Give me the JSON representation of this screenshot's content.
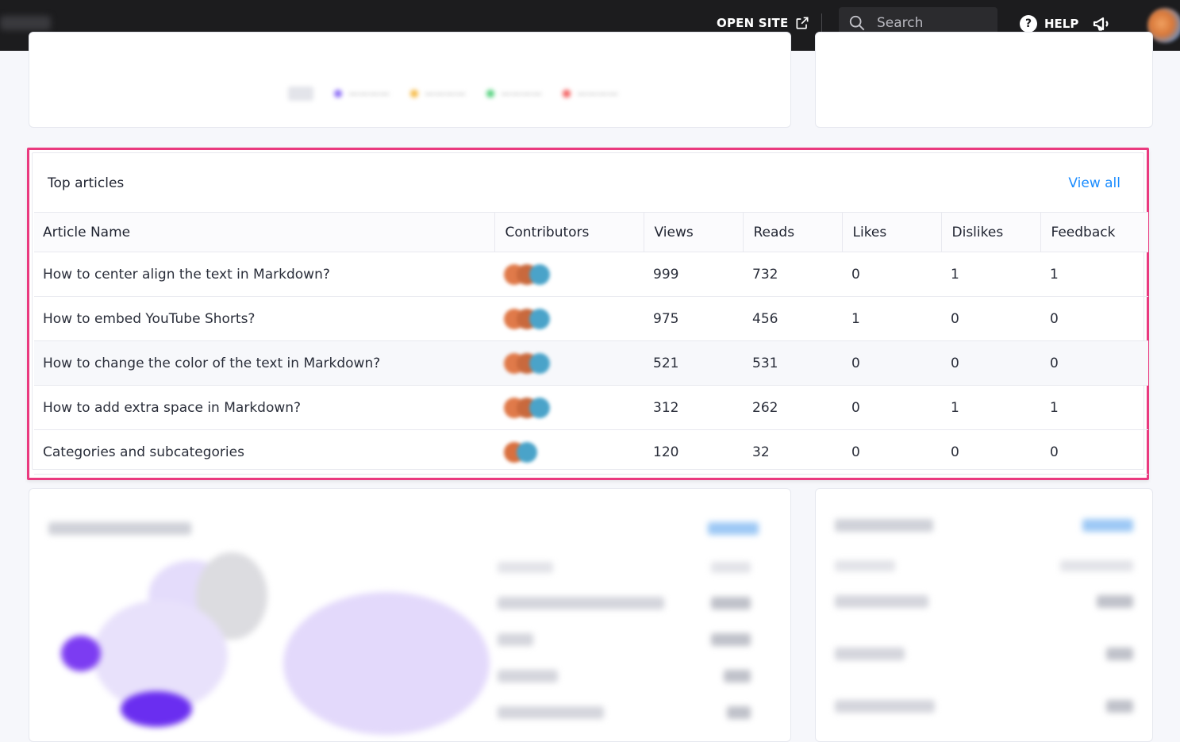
{
  "topbar": {
    "open_site_label": "OPEN SITE",
    "search_placeholder": "Search",
    "help_label": "HELP"
  },
  "top_articles": {
    "title": "Top articles",
    "view_all": "View all",
    "columns": [
      "Article Name",
      "Contributors",
      "Views",
      "Reads",
      "Likes",
      "Dislikes",
      "Feedback"
    ],
    "rows": [
      {
        "name": "How to center align the text in Markdown?",
        "views": "999",
        "reads": "732",
        "likes": "0",
        "dislikes": "1",
        "feedback": "1",
        "contributors": 3
      },
      {
        "name": "How to embed YouTube Shorts?",
        "views": "975",
        "reads": "456",
        "likes": "1",
        "dislikes": "0",
        "feedback": "0",
        "contributors": 3
      },
      {
        "name": "How to change the color of the text in Markdown?",
        "views": "521",
        "reads": "531",
        "likes": "0",
        "dislikes": "0",
        "feedback": "0",
        "contributors": 3
      },
      {
        "name": "How to add extra space in Markdown?",
        "views": "312",
        "reads": "262",
        "likes": "0",
        "dislikes": "1",
        "feedback": "1",
        "contributors": 3
      },
      {
        "name": "Categories and subcategories",
        "views": "120",
        "reads": "32",
        "likes": "0",
        "dislikes": "0",
        "feedback": "0",
        "contributors": 2
      }
    ]
  },
  "colors": {
    "highlight": "#ea3a7f",
    "link": "#1a8cff",
    "topbar": "#1c1c1e"
  }
}
